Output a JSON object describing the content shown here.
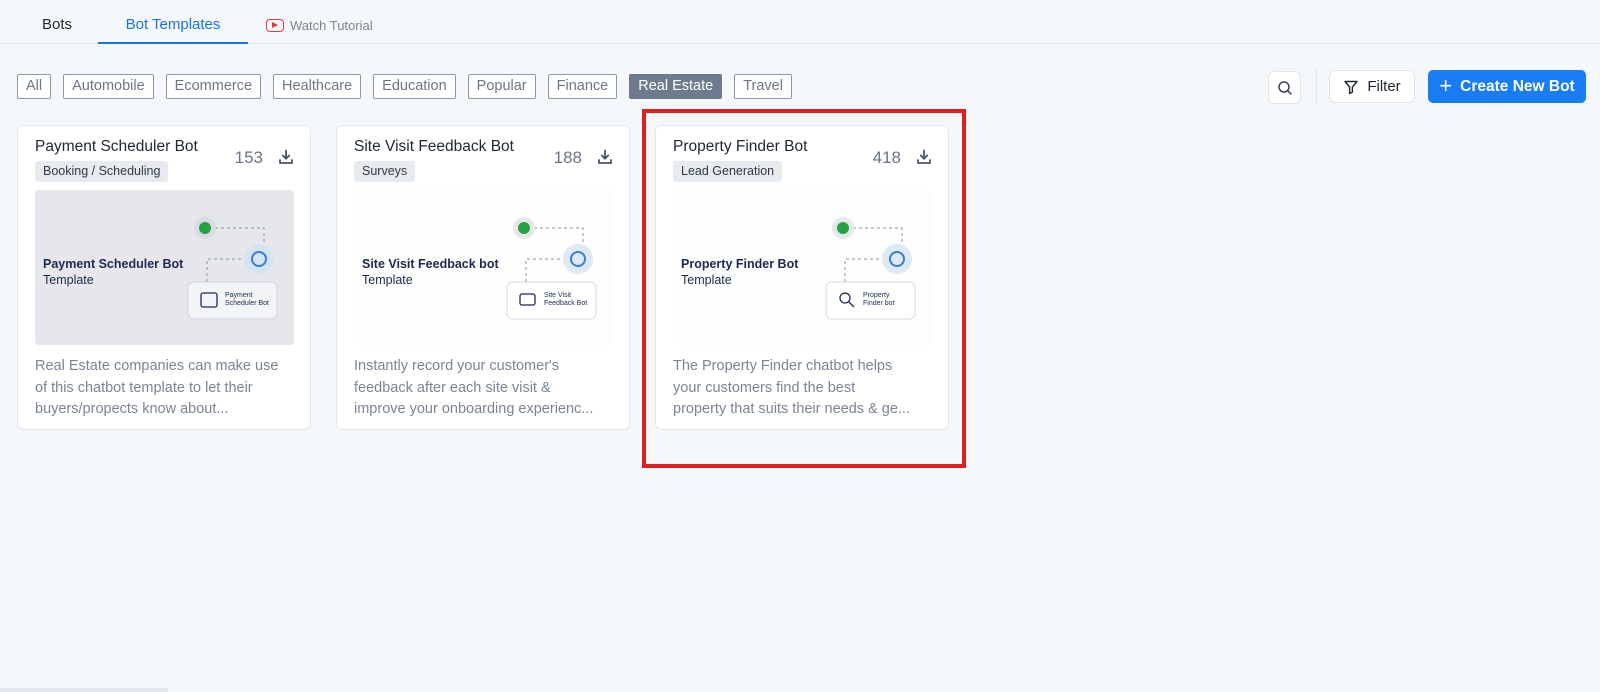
{
  "tabs": {
    "bots": "Bots",
    "bot_templates": "Bot Templates",
    "watch_tutorial": "Watch Tutorial"
  },
  "categories": [
    "All",
    "Automobile",
    "Ecommerce",
    "Healthcare",
    "Education",
    "Popular",
    "Finance",
    "Real Estate",
    "Travel"
  ],
  "active_category": "Real Estate",
  "toolbar": {
    "filter_label": "Filter",
    "create_label": "Create New Bot"
  },
  "cards": [
    {
      "title": "Payment Scheduler Bot",
      "tag": "Booking / Scheduling",
      "downloads": "153",
      "thumb_title": "Payment Scheduler Bot",
      "thumb_sub": "Template",
      "thumb_node": "Payment Scheduler Bot",
      "desc_line1": "Real Estate companies can make use",
      "desc_line2": "of this chatbot template to let their",
      "desc_line3": "buyers/propects know about..."
    },
    {
      "title": "Site Visit Feedback Bot",
      "tag": "Surveys",
      "downloads": "188",
      "thumb_title": "Site Visit Feedback bot",
      "thumb_sub": "Template",
      "thumb_node": "Site Visit Feedback Bot",
      "desc_line1": "Instantly record your customer's",
      "desc_line2": "feedback after each site visit &",
      "desc_line3": "improve your onboarding experienc..."
    },
    {
      "title": "Property Finder Bot",
      "tag": "Lead Generation",
      "downloads": "418",
      "thumb_title": "Property Finder Bot",
      "thumb_sub": "Template",
      "thumb_node": "Property Finder bot",
      "desc_line1": "The Property Finder chatbot helps",
      "desc_line2": "your customers find the best",
      "desc_line3": "property that suits their needs & ge..."
    }
  ],
  "colors": {
    "accent": "#1a7cf5",
    "active_chip": "#6e7b8f",
    "highlight": "#e02020",
    "whatsapp": "#25a244"
  }
}
